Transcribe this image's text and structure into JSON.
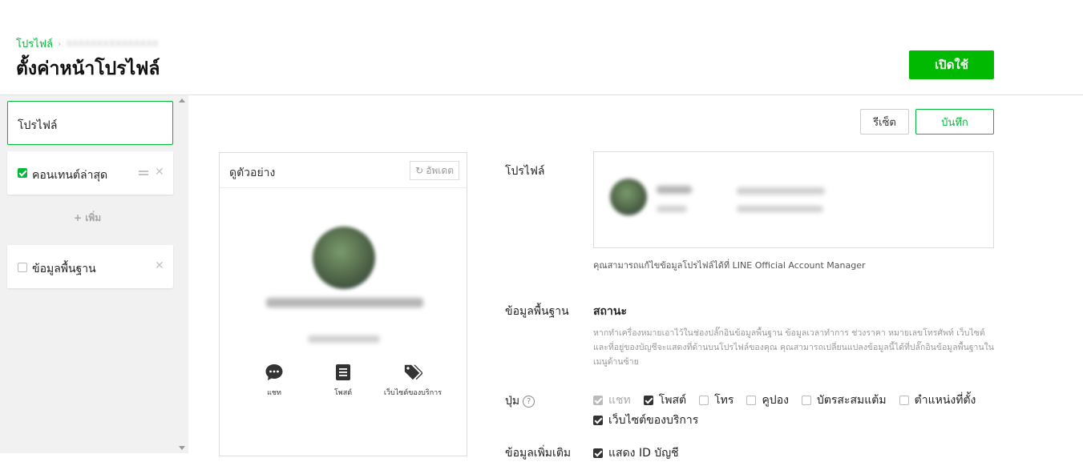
{
  "header": {
    "breadcrumb_root": "โปรไฟล์",
    "breadcrumb_sep": "›",
    "breadcrumb_current": "xxxxxxxxxxxxxxx",
    "title": "ตั้งค่าหน้าโปรไฟล์",
    "enable_button": "เปิดใช้"
  },
  "sidebar": {
    "profile_item": "โปรไฟล์",
    "plugins": [
      {
        "label": "คอนเทนต์ล่าสุด",
        "checked": true
      },
      {
        "label": "ข้อมูลพื้นฐาน",
        "checked": false
      }
    ],
    "add_label": "+ เพิ่ม"
  },
  "toolbar": {
    "reset_label": "รีเซ็ต",
    "save_label": "บันทึก"
  },
  "preview": {
    "title": "ดูตัวอย่าง",
    "update_label": "อัพเดต",
    "buttons": [
      {
        "label": "แชท",
        "icon": "chat-icon"
      },
      {
        "label": "โพสต์",
        "icon": "post-icon"
      },
      {
        "label": "เว็บไซต์ของบริการ",
        "icon": "tag-icon"
      }
    ]
  },
  "form": {
    "profile_label": "โปรไฟล์",
    "profile_note": "คุณสามารถแก้ไขข้อมูลโปรไฟล์ได้ที่ LINE Official Account Manager",
    "basic_label": "ข้อมูลพื้นฐาน",
    "status_label": "สถานะ",
    "status_note": "หากทำเครื่องหมายเอาไว้ในช่องปลั๊กอินข้อมูลพื้นฐาน ข้อมูลเวลาทำการ ช่วงราคา หมายเลขโทรศัพท์ เว็บไซต์ และที่อยู่ของบัญชีจะแสดงที่ด้านบนโปรไฟล์ของคุณ คุณสามารถเปลี่ยนแปลงข้อมูลนี้ได้ที่ปลั๊กอินข้อมูลพื้นฐานในเมนูด้านซ้าย",
    "buttons_label": "ปุ่ม",
    "button_options": [
      {
        "label": "แชท",
        "state": "disabled"
      },
      {
        "label": "โพสต์",
        "state": "checked"
      },
      {
        "label": "โทร",
        "state": "unchecked"
      },
      {
        "label": "คูปอง",
        "state": "unchecked"
      },
      {
        "label": "บัตรสะสมแต้ม",
        "state": "unchecked"
      },
      {
        "label": "ตำแหน่งที่ตั้ง",
        "state": "unchecked"
      },
      {
        "label": "เว็บไซต์ของบริการ",
        "state": "checked"
      }
    ],
    "extra_label": "ข้อมูลเพิ่มเติม",
    "extra_option": "แสดง ID บัญชี"
  },
  "colors": {
    "accent": "#00b900",
    "sidebar_bg": "#f1f1f1"
  }
}
